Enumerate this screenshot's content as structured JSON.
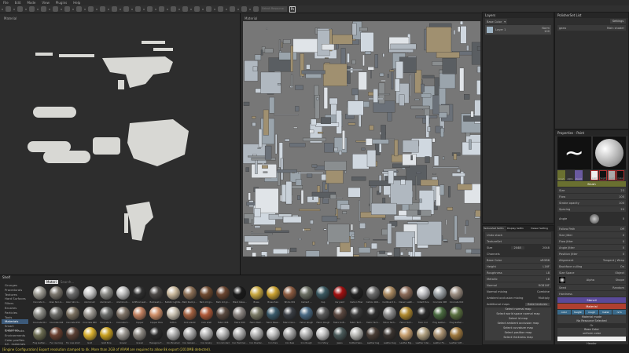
{
  "menu": [
    "File",
    "Edit",
    "Mode",
    "View",
    "Plugins",
    "Help"
  ],
  "toolbar": {
    "preset_placeholder": "Select Resource",
    "ps_label": "Ps"
  },
  "viewport3d": {
    "label": "Material"
  },
  "viewport2d": {
    "label": "Material"
  },
  "layers": {
    "title": "Layers",
    "channel": "Base Color",
    "layer_name": "Layer 1",
    "blend": "Norm",
    "opacity": "100"
  },
  "polisher": {
    "title": "PolisherSet List",
    "settings": "Settings",
    "item": "gaea",
    "shader": "Main shader"
  },
  "properties": {
    "title": "Properties - Paint",
    "tools": [
      "brush",
      "alpha",
      "stencil"
    ],
    "material_swatches": [
      "color",
      "height",
      "rough",
      "metal"
    ],
    "brush_header": "Brush",
    "params": [
      {
        "label": "Size",
        "value": "23"
      },
      {
        "label": "Flow",
        "value": "100"
      },
      {
        "label": "Stroke opacity",
        "value": "100"
      },
      {
        "label": "Spacing",
        "value": "20"
      }
    ],
    "angle_label": "Angle",
    "angle_value": "0",
    "follow_path": "Follow Path",
    "follow_value": "Off",
    "jitters": [
      "Size Jitter",
      "Flow Jitter",
      "Angle Jitter",
      "Position Jitter"
    ],
    "alignment_label": "Alignment",
    "alignment_value": "Tangent | Wrap",
    "backface_label": "Backface culling",
    "backface_value": "On",
    "size_space_label": "Size Space",
    "size_space_value": "Object",
    "alpha_label": "Alpha",
    "alpha_sub": "Shape",
    "seed_label": "Seed",
    "seed_value": "Random",
    "hardness": "Hardness",
    "stencil_header": "Stencil",
    "material_header": "Material",
    "channels": [
      "color",
      "height",
      "rough",
      "metal",
      "nrm"
    ],
    "material_mode": "Material mode",
    "no_resource": "No Resource Selected",
    "or": "Or",
    "base_color": "Base Color",
    "uniform_color": "uniform color",
    "footer": "Header"
  },
  "textureset": {
    "tabs": [
      "TextureSet Settin",
      "Display Settin",
      "Viewer Setting"
    ],
    "undo": "Undo stack",
    "name": "TextureSet",
    "size_label": "Size",
    "size_value": "2048",
    "size_value2": "2048",
    "channels_label": "Channels",
    "channels": [
      {
        "name": "Base Color",
        "fmt": "sRGB8"
      },
      {
        "name": "Height",
        "fmt": "L16F"
      },
      {
        "name": "Roughness",
        "fmt": "L8"
      },
      {
        "name": "Metallic",
        "fmt": "L8"
      },
      {
        "name": "Normal",
        "fmt": "RGB16F"
      }
    ],
    "normal_mixing_label": "Normal mixing",
    "normal_mixing_value": "Combine",
    "ao_mixing_label": "Ambient occlusion mixing",
    "ao_mixing_value": "Multiply",
    "additional_maps": "Additional maps",
    "bake": "Bake textures",
    "maps": [
      "Select normal map",
      "Select world space normal map",
      "Select id map",
      "Select ambient occlusion map",
      "Select curvature map",
      "Select position map",
      "Select thickness map"
    ]
  },
  "shelf": {
    "title": "Shelf",
    "filter": "Materi",
    "search_placeholder": "Search...",
    "categories": [
      "Grunges",
      "Procedurals",
      "Textures",
      "Hard Surfaces",
      "Filters",
      "Brushes",
      "Particles",
      "Tools",
      "Materials",
      "Smart materials",
      "Smart masks",
      "Environments",
      "Color profiles",
      "All - materials"
    ],
    "selected_category": "Materials",
    "rows": [
      [
        [
          "Concrete C...",
          "#9a9890"
        ],
        [
          "Alien Skin G...",
          "#7a756c"
        ],
        [
          "Alien Skin G...",
          "#6a6a6a"
        ],
        [
          "Aluminium",
          "#c8c8c8"
        ],
        [
          "Aluminium...",
          "#8a8a86"
        ],
        [
          "Aluminium...",
          "#bdbdbd"
        ],
        [
          "Artificial Leat...",
          "#2e2e2e"
        ],
        [
          "Backseat p...",
          "#4b4845"
        ],
        [
          "Ballistic Lightw...",
          "#c9b89c"
        ],
        [
          "Bark black p...",
          "#8a6e55"
        ],
        [
          "Bark old gn...",
          "#6e4a30"
        ],
        [
          "Bark old gn...",
          "#6a4530"
        ],
        [
          "Black Glass...",
          "#1a1a1a"
        ],
        [
          "Brass",
          "#c8a840"
        ],
        [
          "Brass Pure",
          "#c9a030"
        ],
        [
          "Bricks 001",
          "#8a5a40"
        ],
        [
          "Cement ...",
          "#6a6e62"
        ],
        [
          "Cap",
          "#3a5860"
        ],
        [
          "Car paint",
          "#a01010"
        ],
        [
          "Carbon Fiber",
          "#222"
        ],
        [
          "Carbon Wet...",
          "#6a6a6a"
        ],
        [
          "Cardboard C...",
          "#a88860"
        ],
        [
          "Classic Leath...",
          "#8a6a58"
        ],
        [
          "Cobalt Pure",
          "#c0c0c4"
        ],
        [
          "Concrete 008",
          "#9aa0a4"
        ],
        [
          "Concrete 010",
          "#9a8c80"
        ]
      ],
      [
        [
          "Concrete 011",
          "#8a8a84"
        ],
        [
          "Concrete 044",
          "#6a6a66"
        ],
        [
          "Concrete 050",
          "#7a7060"
        ],
        [
          "Concrete 060",
          "#9a9690"
        ],
        [
          "Concrete S...",
          "#6a6c6a"
        ],
        [
          "Concrete S...",
          "#807468"
        ],
        [
          "Copper",
          "#c08060"
        ],
        [
          "Copper Pure",
          "#d0906a"
        ],
        [
          "Cotton",
          "#c8c0b0"
        ],
        [
          "Cork elastic",
          "#a06040"
        ],
        [
          "Cork shell",
          "#b05a3a"
        ],
        [
          "Fabric 006",
          "#5a4a40"
        ],
        [
          "Fabric 009",
          "#8a8480"
        ],
        [
          "Fabric Bam...",
          "#7a7a66"
        ],
        [
          "Fabric Base...",
          "#3a5a6a"
        ],
        [
          "Fabric Deni...",
          "#3a3e44"
        ],
        [
          "Fabric Rough",
          "#4a6a84"
        ],
        [
          "Fabric Rough",
          "#5a5a5a"
        ],
        [
          "Fabric Soft...",
          "#5a4840"
        ],
        [
          "Fabric Tech...",
          "#3a3a3a"
        ],
        [
          "Fabric Tech...",
          "#2e2e2e"
        ],
        [
          "Fabric Tech...",
          "#8a8a8a"
        ],
        [
          "Fabric Tech...",
          "#b08a30"
        ],
        [
          "Faux croc",
          "#2a2a2a"
        ],
        [
          "Frog leather...",
          "#4a6a40"
        ],
        [
          "Frog leather...",
          "#5a7040"
        ]
      ],
      [
        [
          "Frog leather...",
          "#6a6a50"
        ],
        [
          "Fur cow long",
          "#6a4030"
        ],
        [
          "Fur cow short",
          "#5a4034"
        ],
        [
          "Gold",
          "#d8b030"
        ],
        [
          "Gold Pure",
          "#c8a020"
        ],
        [
          "Gravel",
          "#9a9690"
        ],
        [
          "Gravel",
          "#8a8680"
        ],
        [
          "Hexagons T...",
          "#2a2a2a"
        ],
        [
          "Iron Brushed",
          "#b0b0b0"
        ],
        [
          "Iron Galvani...",
          "#a8a8a8"
        ],
        [
          "Iron Grainy",
          "#b4b4b4"
        ],
        [
          "Iron Grinded",
          "#b8b8b8"
        ],
        [
          "Iron Hammer...",
          "#acacac"
        ],
        [
          "Iron Powder...",
          "#b2b2b2"
        ],
        [
          "Iron Pure",
          "#c0c0c0"
        ],
        [
          "Iron Raw",
          "#a4a4a4"
        ],
        [
          "Iron Rough",
          "#b0b0b0"
        ],
        [
          "Iron Shiny",
          "#c4c4c4"
        ],
        [
          "Jeans",
          "#4a5a5a"
        ],
        [
          "Knitted Swe...",
          "#b8b8b4"
        ],
        [
          "Leather bag",
          "#4a3e36"
        ],
        [
          "Leather bag",
          "#3a3430"
        ],
        [
          "Leather Big...",
          "#c8a070"
        ],
        [
          "Leather Inter...",
          "#b0a080"
        ],
        [
          "Leather Fin...",
          "#a89070"
        ],
        [
          "Leather Soft...",
          "#a07a40"
        ]
      ]
    ]
  },
  "status": "[Engine Configuration] Export resolution clamped to 4k. More than 2GB of VRAM are required to allow 8k export (2010MB detected)."
}
